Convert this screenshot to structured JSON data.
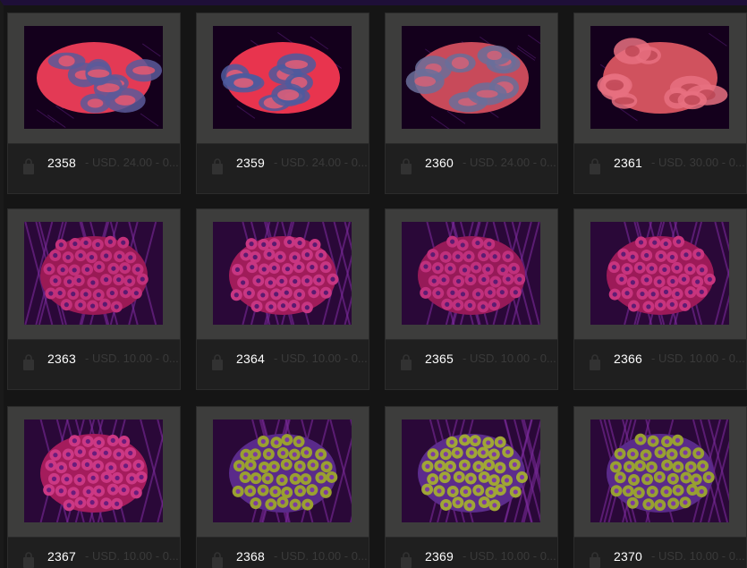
{
  "lots": [
    {
      "number": "2358",
      "price": "- USD. 24.00 - 0...",
      "coral": "brain-red-green",
      "colors": [
        "#e33a55",
        "#5a5a9a",
        "#ff5a6a"
      ]
    },
    {
      "number": "2359",
      "price": "- USD. 24.00 - 0...",
      "coral": "brain-red-green",
      "colors": [
        "#e8344e",
        "#4e5a9e",
        "#ff6070"
      ]
    },
    {
      "number": "2360",
      "price": "- USD. 24.00 - 0...",
      "coral": "brain-red-green",
      "colors": [
        "#c84a5a",
        "#6a6f9a",
        "#e86070"
      ]
    },
    {
      "number": "2361",
      "price": "- USD. 30.00 - 0...",
      "coral": "brain-red",
      "colors": [
        "#d0525e",
        "#e87080",
        "#b8404e"
      ]
    },
    {
      "number": "2363",
      "price": "- USD. 10.00 - 0...",
      "sub": "",
      "coral": "zoa-red",
      "colors": [
        "#9a1a55",
        "#c2307a",
        "#5a1a70"
      ]
    },
    {
      "number": "2364",
      "price": "- USD. 10.00 - 0...",
      "coral": "zoa-red",
      "colors": [
        "#a01c5a",
        "#c83682",
        "#5a1a70"
      ]
    },
    {
      "number": "2365",
      "price": "- USD. 10.00 - 0...",
      "coral": "zoa-red",
      "colors": [
        "#961a58",
        "#c0307c",
        "#5c1c72"
      ]
    },
    {
      "number": "2366",
      "price": "- USD. 10.00 - 0...",
      "coral": "zoa-red",
      "colors": [
        "#9c1a58",
        "#c8347e",
        "#5e1c74"
      ]
    },
    {
      "number": "2367",
      "price": "- USD. 10.00 - 0...",
      "coral": "zoa-red",
      "colors": [
        "#a41c5c",
        "#cc3884",
        "#6a1c7c"
      ]
    },
    {
      "number": "2368",
      "price": "- USD. 10.00 - 0...",
      "coral": "zoa-green",
      "colors": [
        "#5a2a8a",
        "#9aa030",
        "#7a3aa0"
      ]
    },
    {
      "number": "2369",
      "price": "- USD. 10.00 - 0...",
      "coral": "zoa-green",
      "colors": [
        "#5c2c8c",
        "#a0a636",
        "#7c3ca2"
      ]
    },
    {
      "number": "2370",
      "price": "- USD. 10.00 - 0...",
      "coral": "zoa-green",
      "colors": [
        "#5a2a8a",
        "#98a032",
        "#7a3aa0"
      ]
    }
  ],
  "icons": {
    "cart": "cart-icon"
  }
}
